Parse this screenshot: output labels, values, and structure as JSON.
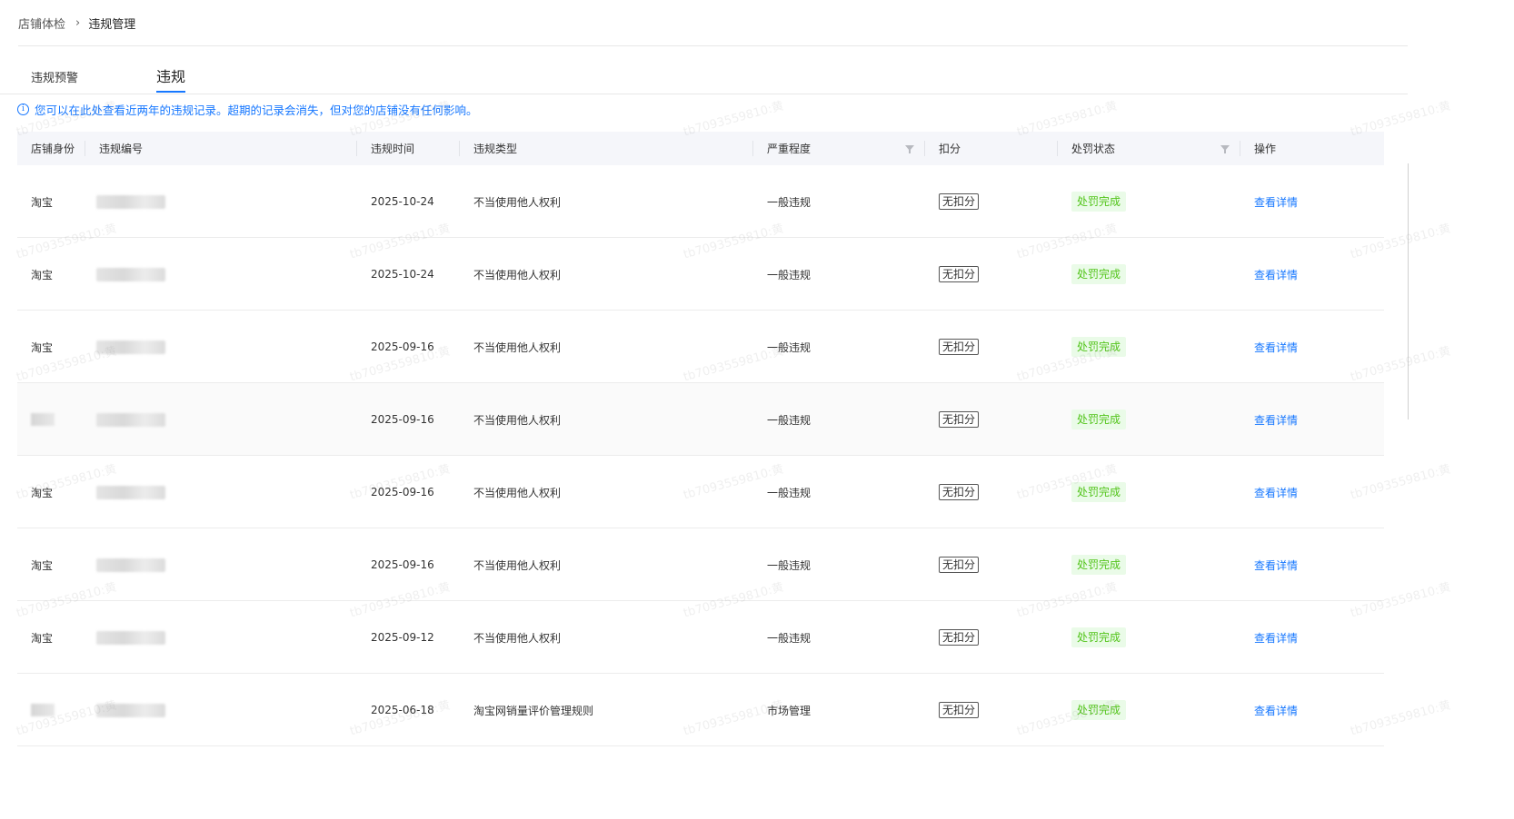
{
  "breadcrumb": {
    "parent": "店铺体检",
    "separator": "›",
    "current": "违规管理"
  },
  "tabs": [
    {
      "label": "违规预警"
    },
    {
      "label": "违规",
      "active": true
    }
  ],
  "notice": {
    "icon": "info-icon",
    "text": "您可以在此处查看近两年的违规记录。超期的记录会消失，但对您的店铺没有任何影响。"
  },
  "table": {
    "columns": {
      "shop_identity": "店铺身份",
      "violation_no": "违规编号",
      "violation_time": "违规时间",
      "violation_type": "违规类型",
      "severity": "严重程度",
      "points": "扣分",
      "status": "处罚状态",
      "action": "操作"
    },
    "rows": [
      {
        "shop": "淘宝",
        "date": "2025-10-24",
        "type": "不当使用他人权利",
        "severity": "一般违规",
        "points": "无扣分",
        "status": "处罚完成",
        "action": "查看详情"
      },
      {
        "shop": "淘宝",
        "date": "2025-10-24",
        "type": "不当使用他人权利",
        "severity": "一般违规",
        "points": "无扣分",
        "status": "处罚完成",
        "action": "查看详情"
      },
      {
        "shop": "淘宝",
        "date": "2025-09-16",
        "type": "不当使用他人权利",
        "severity": "一般违规",
        "points": "无扣分",
        "status": "处罚完成",
        "action": "查看详情"
      },
      {
        "shop": "",
        "date": "2025-09-16",
        "type": "不当使用他人权利",
        "severity": "一般违规",
        "points": "无扣分",
        "status": "处罚完成",
        "action": "查看详情"
      },
      {
        "shop": "淘宝",
        "date": "2025-09-16",
        "type": "不当使用他人权利",
        "severity": "一般违规",
        "points": "无扣分",
        "status": "处罚完成",
        "action": "查看详情"
      },
      {
        "shop": "淘宝",
        "date": "2025-09-16",
        "type": "不当使用他人权利",
        "severity": "一般违规",
        "points": "无扣分",
        "status": "处罚完成",
        "action": "查看详情"
      },
      {
        "shop": "淘宝",
        "date": "2025-09-12",
        "type": "不当使用他人权利",
        "severity": "一般违规",
        "points": "无扣分",
        "status": "处罚完成",
        "action": "查看详情"
      },
      {
        "shop": "",
        "date": "2025-06-18",
        "type": "淘宝网销量评价管理规则",
        "severity": "市场管理",
        "points": "无扣分",
        "status": "处罚完成",
        "action": "查看详情"
      }
    ]
  },
  "watermark": {
    "text": "tb7093559810:黄"
  },
  "colors": {
    "accent": "#1677ff",
    "status_green": "#52c41a",
    "status_bg": "#eafbe8",
    "header_bg": "#f5f6fa"
  }
}
